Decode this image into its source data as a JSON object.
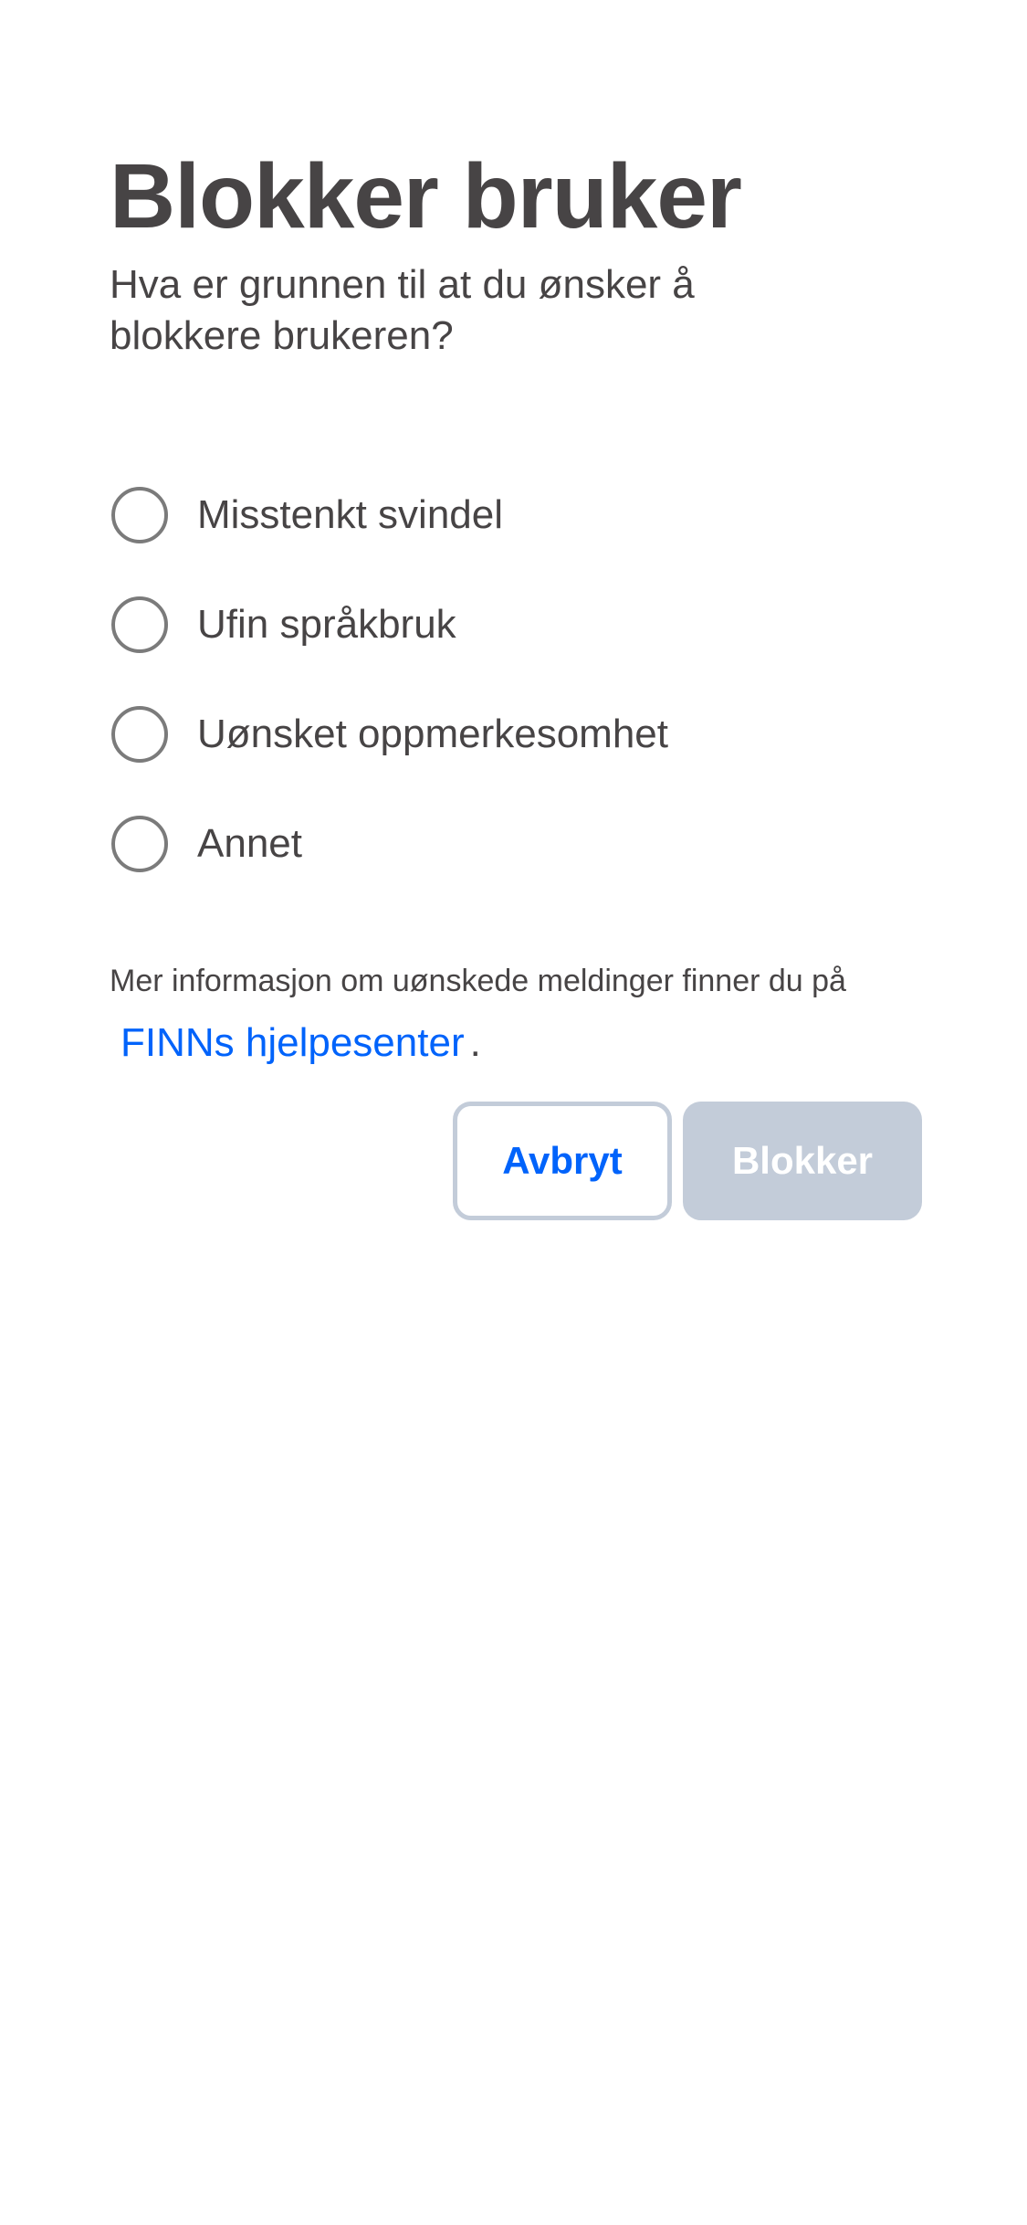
{
  "dialog": {
    "title": "Blokker bruker",
    "subtitle": "Hva er grunnen til at du ønsker å blokkere brukeren?",
    "options": [
      {
        "label": "Misstenkt svindel",
        "selected": false
      },
      {
        "label": "Ufin språkbruk",
        "selected": false
      },
      {
        "label": "Uønsket oppmerkesomhet",
        "selected": false
      },
      {
        "label": "Annet",
        "selected": false
      }
    ],
    "info_text": "Mer informasjon om uønskede meldinger finner du på",
    "info_link": "FINNs hjelpesenter",
    "info_period": ".",
    "cancel_label": "Avbryt",
    "block_label": "Blokker",
    "block_enabled": false
  },
  "colors": {
    "text": "#474445",
    "link": "#0063fb",
    "radio_border": "#7b7b7b",
    "disabled_button": "#c3ccd9",
    "background": "#ffffff"
  }
}
